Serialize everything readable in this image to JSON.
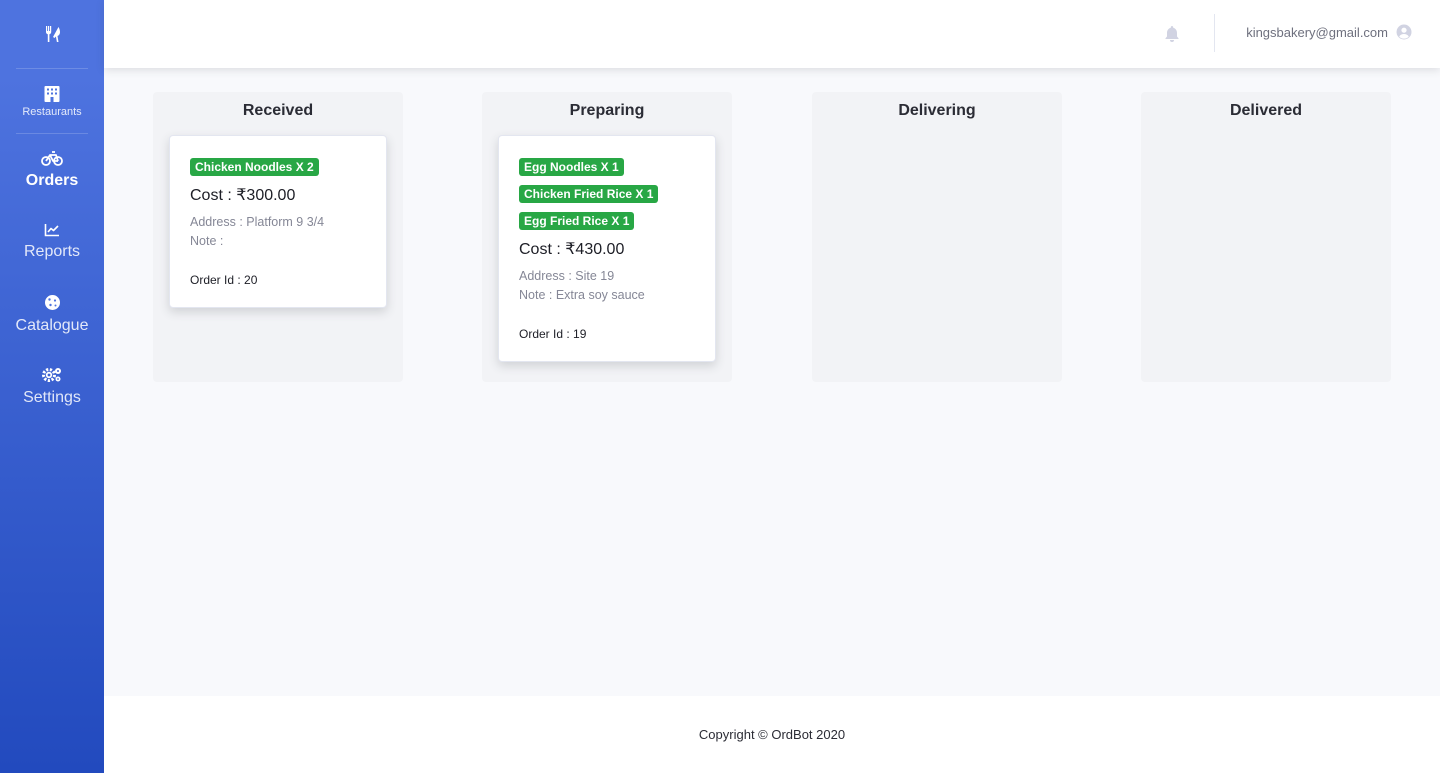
{
  "sidebar": {
    "items": [
      {
        "label": "Restaurants",
        "icon": "building-icon"
      },
      {
        "label": "Orders",
        "icon": "bicycle-icon"
      },
      {
        "label": "Reports",
        "icon": "chart-line-icon"
      },
      {
        "label": "Catalogue",
        "icon": "cookie-icon"
      },
      {
        "label": "Settings",
        "icon": "cogs-icon"
      }
    ],
    "brand_icon": "utensils-icon",
    "active": "Orders"
  },
  "topbar": {
    "user_email": "kingsbakery@gmail.com"
  },
  "board": {
    "columns": [
      {
        "title": "Received",
        "cards": [
          {
            "items": [
              "Chicken Noodles X 2"
            ],
            "cost": "Cost : ₹300.00",
            "address": "Address : Platform 9 3/4",
            "note": "Note :",
            "order_id": "Order Id : 20"
          }
        ]
      },
      {
        "title": "Preparing",
        "cards": [
          {
            "items": [
              "Egg Noodles X 1",
              "Chicken Fried Rice X 1",
              "Egg Fried Rice X 1"
            ],
            "cost": "Cost : ₹430.00",
            "address": "Address : Site 19",
            "note": "Note : Extra soy sauce",
            "order_id": "Order Id : 19"
          }
        ]
      },
      {
        "title": "Delivering",
        "cards": []
      },
      {
        "title": "Delivered",
        "cards": []
      }
    ]
  },
  "footer": {
    "copyright": "Copyright © OrdBot 2020"
  },
  "colors": {
    "sidebar_gradient_top": "#4e73df",
    "sidebar_gradient_bottom": "#224abe",
    "badge_green": "#28a745"
  }
}
